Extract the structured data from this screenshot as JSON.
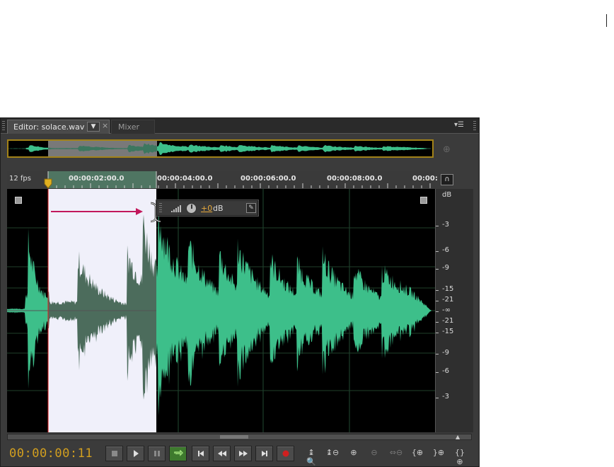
{
  "editor": {
    "tabs": [
      {
        "label": "Editor: solace.wav",
        "active": true
      },
      {
        "label": "Mixer",
        "active": false
      }
    ],
    "tab_dropdown_icon": "▼",
    "tab_close_icon": "×",
    "panel_menu_icon": "▾☰"
  },
  "ruler": {
    "fps": "12 fps",
    "ticks": [
      "00:00:02:00.0",
      "00:00:04:00.0",
      "00:00:06:00.0",
      "00:00:08:00.0",
      "00:00:"
    ]
  },
  "hud": {
    "value": "+0",
    "unit": "dB"
  },
  "db_scale": {
    "title": "dB",
    "labels": [
      "-3",
      "-6",
      "-9",
      "-15",
      "-21",
      "-∞",
      "-21",
      "-15",
      "-9",
      "-6",
      "-3"
    ]
  },
  "transport": {
    "timecode": "00:00:00:11",
    "buttons": [
      "stop",
      "play",
      "pause",
      "loop",
      "go-to-start",
      "rewind",
      "fast-forward",
      "go-to-end",
      "record"
    ]
  },
  "zoom": {
    "buttons": [
      "zoom-in-amplitude",
      "zoom-out-amplitude",
      "zoom-in-time",
      "zoom-out-time",
      "zoom-out-full",
      "zoom-in-left",
      "zoom-in-right",
      "zoom-to-selection"
    ]
  },
  "colors": {
    "waveform": "#3dbf8a",
    "waveform_selected": "#4c6c5c",
    "selection": "#f0f0fa",
    "timecode": "#d29f1f",
    "playhead": "#e02020",
    "annotation_arrow": "#c2185b",
    "record": "#d02020"
  }
}
